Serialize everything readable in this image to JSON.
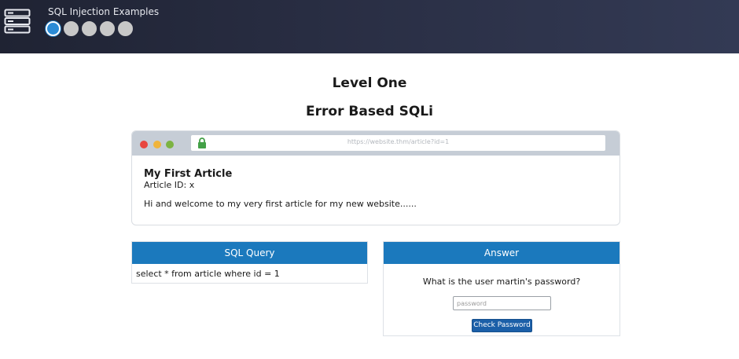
{
  "header": {
    "app_title": "SQL Injection Examples",
    "steps": 5,
    "active_step": 1,
    "icon": "server-icon"
  },
  "level": {
    "title": "Level One",
    "subtitle": "Error Based SQLi"
  },
  "browser": {
    "url": "https://website.thm/article?id=1",
    "lock_icon": "lock-icon",
    "lock_color": "#43a047"
  },
  "article": {
    "title": "My First Article",
    "id_line": "Article ID: x",
    "body": "Hi and welcome to my very first article for my new website......"
  },
  "sql_panel": {
    "header": "SQL Query",
    "query": "select * from article where id = 1"
  },
  "answer_panel": {
    "header": "Answer",
    "question": "What is the user martin's password?",
    "input_placeholder": "password",
    "input_value": "",
    "button_label": "Check Password"
  },
  "colors": {
    "panel_header": "#1b79bd",
    "button": "#1b5fa8",
    "active_step": "#2a8bd6"
  }
}
